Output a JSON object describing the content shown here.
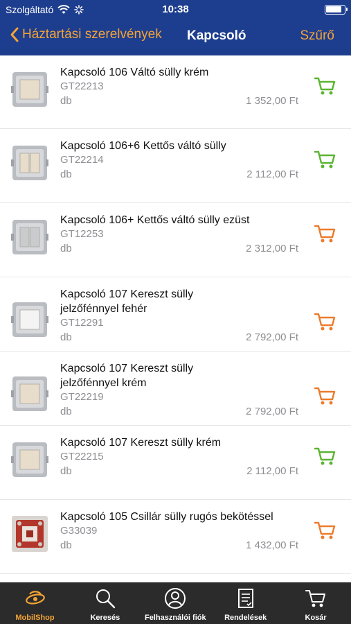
{
  "status": {
    "carrier": "Szolgáltató",
    "time": "10:38"
  },
  "nav": {
    "back_label": "Háztartási szerelvények",
    "title": "Kapcsoló",
    "filter_label": "Szűrő"
  },
  "colors": {
    "header_bg": "#1d3d8f",
    "accent": "#f4a435",
    "cart_green": "#5bb531",
    "cart_orange": "#ec7b2c",
    "tabbar_bg": "#2b2b2b"
  },
  "products": [
    {
      "name": "Kapcsoló 106 Váltó sülly krém",
      "code": "GT22213",
      "unit": "db",
      "price": "1 352,00 Ft",
      "cart_color": "green",
      "thumb": "single-switch-cream"
    },
    {
      "name": "Kapcsoló 106+6 Kettős váltó sülly",
      "code": "GT22214",
      "unit": "db",
      "price": "2 112,00 Ft",
      "cart_color": "green",
      "thumb": "double-switch-cream"
    },
    {
      "name": "Kapcsoló 106+ Kettős váltó sülly ezüst",
      "code": "GT12253",
      "unit": "db",
      "price": "2 312,00 Ft",
      "cart_color": "orange",
      "thumb": "double-switch-silver"
    },
    {
      "name": "Kapcsoló 107 Kereszt sülly jelzőfénnyel fehér",
      "code": "GT12291",
      "unit": "db",
      "price": "2 792,00 Ft",
      "cart_color": "orange",
      "thumb": "single-switch-white"
    },
    {
      "name": "Kapcsoló 107 Kereszt sülly jelzőfénnyel krém",
      "code": "GT22219",
      "unit": "db",
      "price": "2 792,00 Ft",
      "cart_color": "orange",
      "thumb": "single-switch-cream"
    },
    {
      "name": "Kapcsoló 107 Kereszt sülly krém",
      "code": "GT22215",
      "unit": "db",
      "price": "2 112,00 Ft",
      "cart_color": "green",
      "thumb": "single-switch-cream"
    },
    {
      "name": "Kapcsoló 105 Csillár sülly rugós bekötéssel",
      "code": "G33039",
      "unit": "db",
      "price": "1 432,00 Ft",
      "cart_color": "orange",
      "thumb": "switch-mechanism-red"
    }
  ],
  "tabs": [
    {
      "label": "MobilShop",
      "icon": "mobilshop-logo-icon",
      "active": true
    },
    {
      "label": "Keresés",
      "icon": "search-icon",
      "active": false
    },
    {
      "label": "Felhasználói fiók",
      "icon": "user-icon",
      "active": false
    },
    {
      "label": "Rendelések",
      "icon": "orders-icon",
      "active": false
    },
    {
      "label": "Kosár",
      "icon": "cart-icon",
      "active": false
    }
  ]
}
